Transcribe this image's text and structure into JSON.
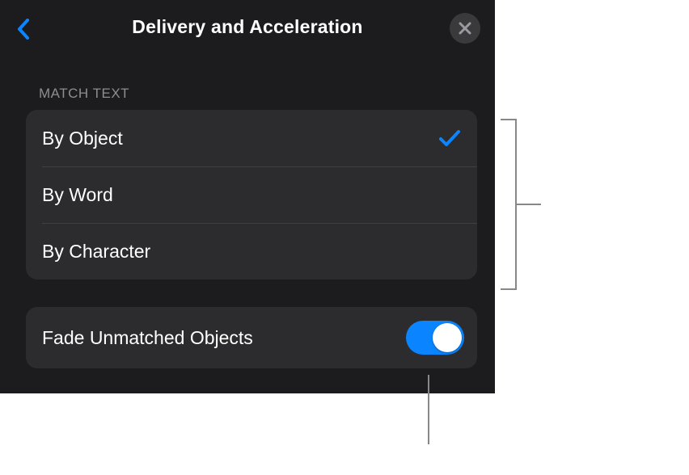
{
  "header": {
    "title": "Delivery and Acceleration"
  },
  "section": {
    "label": "MATCH TEXT",
    "options": [
      {
        "label": "By Object",
        "selected": true
      },
      {
        "label": "By Word",
        "selected": false
      },
      {
        "label": "By Character",
        "selected": false
      }
    ]
  },
  "toggle": {
    "label": "Fade Unmatched Objects",
    "on": true
  },
  "colors": {
    "accent": "#0a84ff",
    "panel_bg": "#1c1c1e",
    "row_bg": "#2c2c2e"
  }
}
